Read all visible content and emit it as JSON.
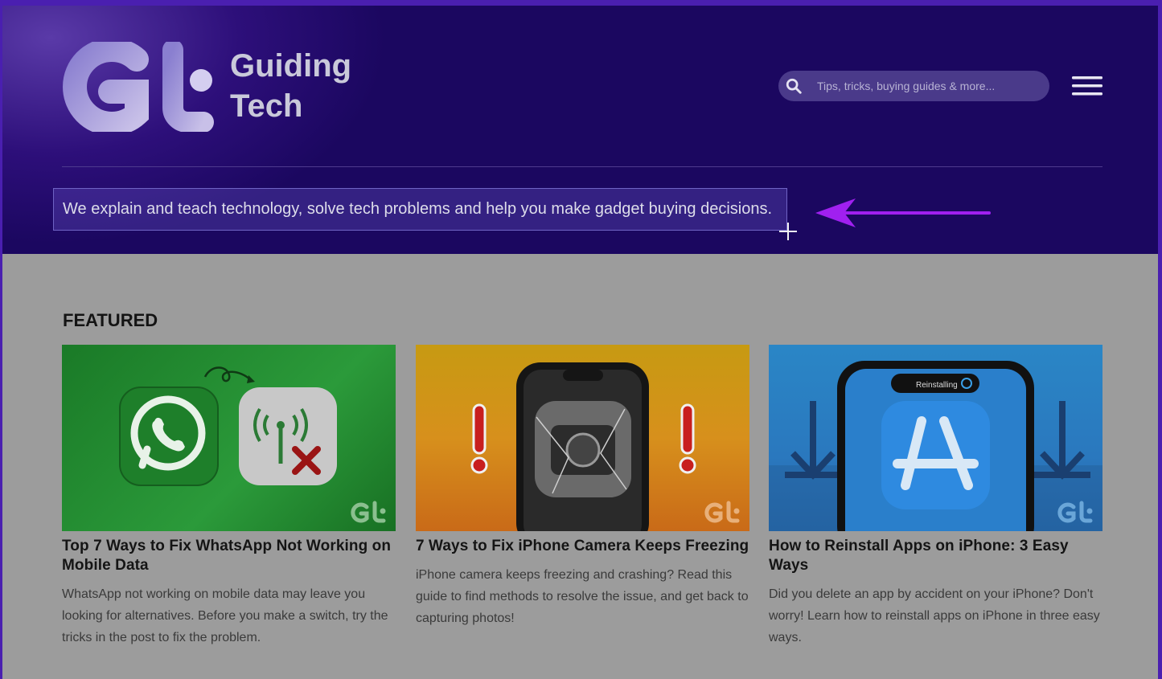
{
  "brand": {
    "line1": "Guiding",
    "line2": "Tech",
    "accent": "#2d0f7a",
    "arrow_color": "#a020f0"
  },
  "search": {
    "placeholder": "Tips, tricks, buying guides & more..."
  },
  "tagline": "We explain and teach technology, solve tech problems and help you make gadget buying decisions.",
  "featured": {
    "heading": "FEATURED",
    "cards": [
      {
        "title": "Top 7 Ways to Fix WhatsApp Not Working on Mobile Data",
        "description": "WhatsApp not working on mobile data may leave you looking for alternatives. Before you make a switch, try the tricks in the post to fix the problem.",
        "thumbnail_icon": "whatsapp-no-signal-icon",
        "thumbnail_color": "#1f8a2c"
      },
      {
        "title": "7 Ways to Fix iPhone Camera Keeps Freezing",
        "description": "iPhone camera keeps freezing and crashing? Read this guide to find methods to resolve the issue, and get back to capturing photos!",
        "thumbnail_icon": "frozen-camera-icon",
        "thumbnail_color": "#c9a018"
      },
      {
        "title": "How to Reinstall Apps on iPhone: 3 Easy Ways",
        "description": "Did you delete an app by accident on your iPhone? Don't worry! Learn how to reinstall apps on iPhone in three easy ways.",
        "thumbnail_icon": "app-store-icon",
        "thumbnail_color": "#2a7fc4",
        "thumbnail_badge": "Reinstalling"
      }
    ]
  }
}
